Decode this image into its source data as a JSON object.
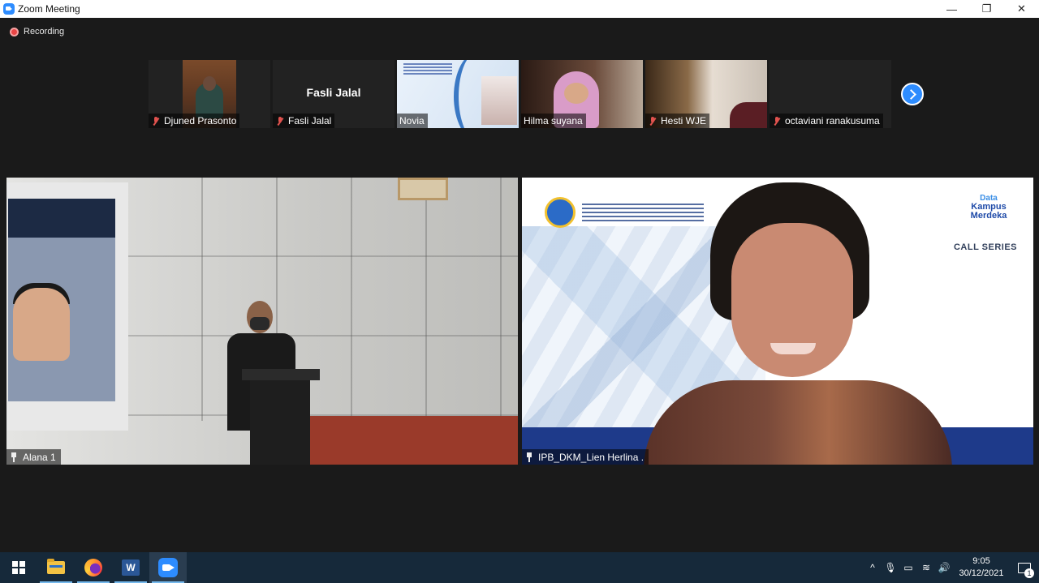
{
  "window": {
    "title": "Zoom Meeting",
    "controls": {
      "minimize": "—",
      "restore": "❐",
      "close": "✕"
    }
  },
  "recording": {
    "label": "Recording"
  },
  "thumbnails": [
    {
      "name": "Djuned Prasonto",
      "muted": true
    },
    {
      "name": "Fasli Jalal",
      "muted": true,
      "center_name": "Fasli Jalal"
    },
    {
      "name": "Novia",
      "muted": false
    },
    {
      "name": "Hilma suyana",
      "muted": false
    },
    {
      "name": "Hesti  WJE",
      "muted": true
    },
    {
      "name": "octaviani ranakusuma",
      "muted": true
    }
  ],
  "main_videos": {
    "left": {
      "name": "Alana 1"
    },
    "right": {
      "name": "IPB_DKM_Lien Herlina .",
      "brand_line1": "Data",
      "brand_line2": "Kampus",
      "brand_line3": "Merdeka",
      "brand_sub": "CALL SERIES"
    }
  },
  "taskbar": {
    "word_letter": "W",
    "tray": {
      "chevron": "^",
      "mic": "🎙",
      "battery": "▭",
      "wifi": "≋",
      "volume": "🔊"
    },
    "time": "9:05",
    "date": "30/12/2021",
    "notification_count": "1"
  }
}
